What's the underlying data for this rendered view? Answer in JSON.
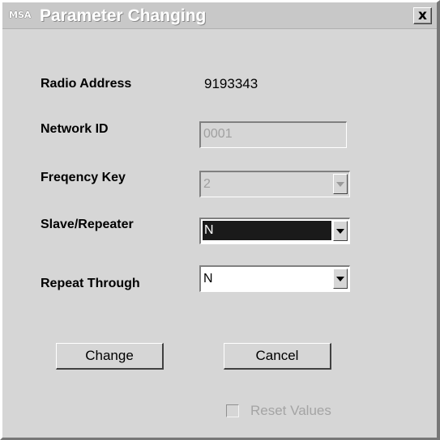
{
  "window": {
    "title": "Parameter Changing",
    "app_icon_text": "MSA",
    "close_glyph": "x",
    "icons": [
      "msa-logo-icon",
      "close-icon"
    ]
  },
  "form": {
    "radio_address": {
      "label": "Radio Address",
      "value": "9193343"
    },
    "network_id": {
      "label": "Network ID",
      "value": "0001",
      "enabled": false
    },
    "frequency_key": {
      "label": "Freqency Key",
      "value": "2",
      "enabled": false
    },
    "slave_repeater": {
      "label": "Slave/Repeater",
      "value": "N",
      "selected": true
    },
    "repeat_through": {
      "label": "Repeat Through",
      "value": "N"
    }
  },
  "buttons": {
    "change": "Change",
    "cancel": "Cancel"
  },
  "reset": {
    "label": "Reset Values",
    "checked": false,
    "enabled": false
  }
}
